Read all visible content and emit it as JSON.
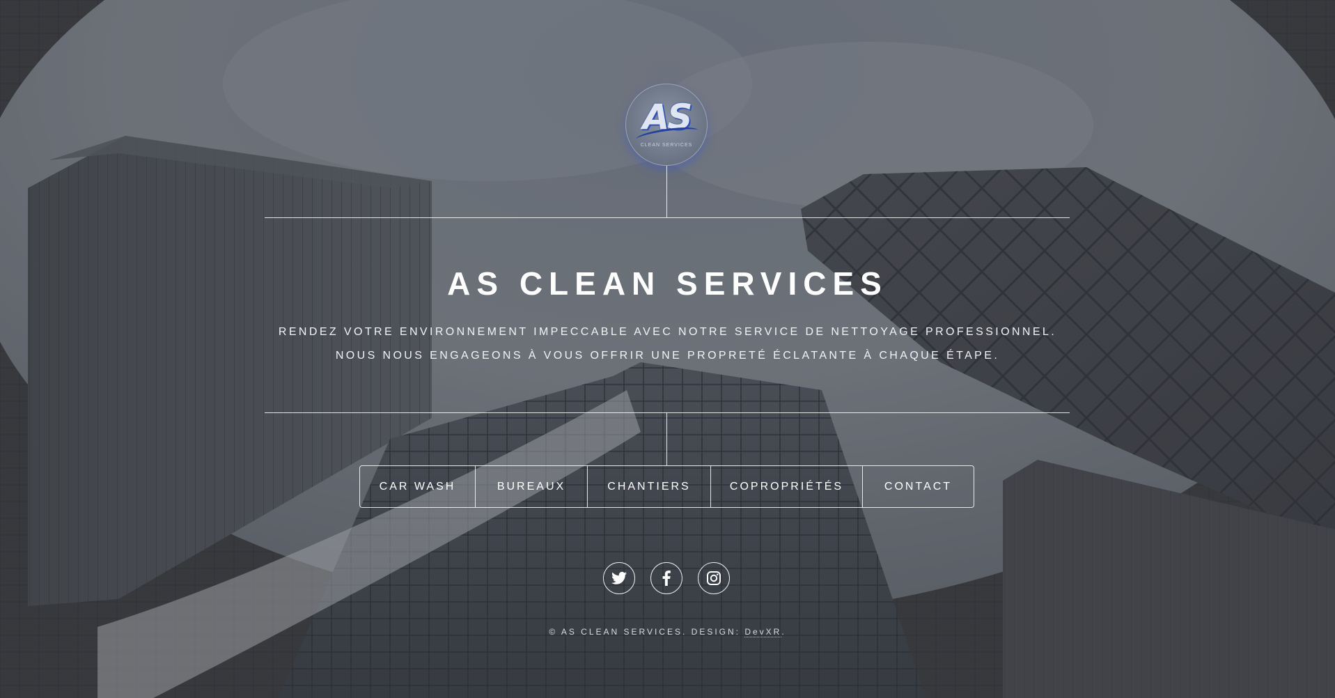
{
  "brand": {
    "logo_text": "AS",
    "logo_subtext": "CLEAN SERVICES",
    "title": "AS CLEAN SERVICES"
  },
  "tagline": {
    "line1": "RENDEZ VOTRE ENVIRONNEMENT IMPECCABLE AVEC NOTRE SERVICE DE NETTOYAGE PROFESSIONNEL.",
    "line2": "NOUS NOUS ENGAGEONS À VOUS OFFRIR UNE PROPRETÉ ÉCLATANTE À CHAQUE ÉTAPE."
  },
  "nav": {
    "items": [
      {
        "label": "CAR WASH"
      },
      {
        "label": "BUREAUX"
      },
      {
        "label": "CHANTIERS"
      },
      {
        "label": "COPROPRIÉTÉS"
      },
      {
        "label": "CONTACT"
      }
    ]
  },
  "social": [
    {
      "icon": "twitter-icon"
    },
    {
      "icon": "facebook-icon"
    },
    {
      "icon": "instagram-icon"
    }
  ],
  "footer": {
    "copyright": "© AS CLEAN SERVICES. DESIGN: ",
    "design_link": "DevXR",
    "suffix": "."
  },
  "colors": {
    "overlay": "#3a3e44",
    "text": "#ffffff",
    "logo_accent": "#3052b8"
  }
}
